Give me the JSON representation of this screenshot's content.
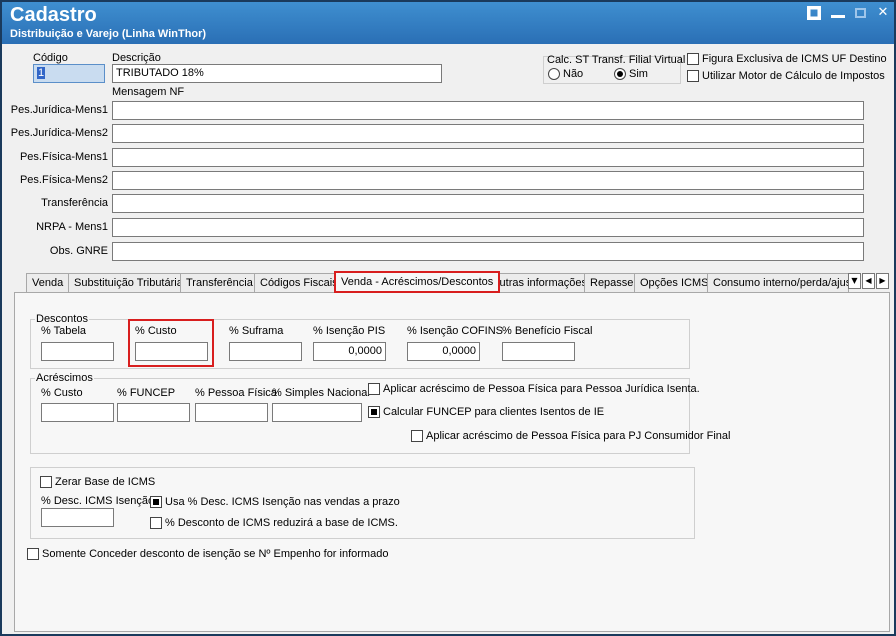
{
  "window": {
    "title": "Cadastro",
    "subtitle": "Distribuição e Varejo (Linha WinThor)"
  },
  "header": {
    "codigo_label": "Código",
    "codigo_value": "1",
    "descricao_label": "Descrição",
    "descricao_value": "TRIBUTADO 18%",
    "mensagem_label": "Mensagem NF",
    "calc_st_label": "Calc. ST Transf. Filial Virtual",
    "radio_nao": "Não",
    "radio_sim": "Sim",
    "radio_selected": "Sim",
    "figura_exclusiva_label": "Figura Exclusiva de ICMS UF Destino",
    "figura_exclusiva_checked": false,
    "utilizar_motor_label": "Utilizar Motor de Cálculo de Impostos",
    "utilizar_motor_checked": false
  },
  "message_fields": [
    {
      "label": "Pes.Jurídica-Mens1",
      "value": ""
    },
    {
      "label": "Pes.Jurídica-Mens2",
      "value": ""
    },
    {
      "label": "Pes.Física-Mens1",
      "value": ""
    },
    {
      "label": "Pes.Física-Mens2",
      "value": ""
    },
    {
      "label": "Transferência",
      "value": ""
    },
    {
      "label": "NRPA - Mens1",
      "value": ""
    },
    {
      "label": "Obs. GNRE",
      "value": ""
    }
  ],
  "tabs": [
    {
      "label": "Venda"
    },
    {
      "label": "Substituição Tributária"
    },
    {
      "label": "Transferência"
    },
    {
      "label": "Códigos Fiscais"
    },
    {
      "label": "Venda - Acréscimos/Descontos"
    },
    {
      "label": "Outras informações"
    },
    {
      "label": "Repasse"
    },
    {
      "label": "Opções ICMS"
    },
    {
      "label": "Consumo interno/perda/ajuste"
    }
  ],
  "active_tab": "Venda - Acréscimos/Descontos",
  "descontos": {
    "group_label": "Descontos",
    "fields": [
      {
        "label": "% Tabela",
        "value": ""
      },
      {
        "label": "% Custo",
        "value": ""
      },
      {
        "label": "% Suframa",
        "value": ""
      },
      {
        "label": "% Isenção PIS",
        "value": "0,0000"
      },
      {
        "label": "% Isenção COFINS",
        "value": "0,0000"
      },
      {
        "label": "% Benefício Fiscal",
        "value": ""
      }
    ]
  },
  "acrescimos": {
    "group_label": "Acréscimos",
    "fields": [
      {
        "label": "% Custo",
        "value": ""
      },
      {
        "label": "% FUNCEP",
        "value": ""
      },
      {
        "label": "% Pessoa Física",
        "value": ""
      },
      {
        "label": "% Simples Nacional",
        "value": ""
      }
    ],
    "checks": [
      {
        "label": "Aplicar acréscimo de Pessoa Física para Pessoa Jurídica Isenta.",
        "checked": false
      },
      {
        "label": "Calcular FUNCEP para clientes Isentos de IE",
        "checked": true
      },
      {
        "label": "Aplicar acréscimo de Pessoa Física para PJ Consumidor Final",
        "checked": false
      }
    ]
  },
  "icms": {
    "zerar_label": "Zerar Base de ICMS",
    "zerar_checked": false,
    "desc_isencao_label": "% Desc. ICMS Isenção",
    "desc_isencao_value": "",
    "usa_desc_label": "Usa % Desc. ICMS Isenção nas vendas a prazo",
    "usa_desc_checked": true,
    "reduzira_label": "% Desconto de ICMS reduzirá a base de ICMS.",
    "reduzira_checked": false
  },
  "somente_conceder_label": "Somente Conceder desconto de isenção se Nº Empenho for informado",
  "somente_conceder_checked": false,
  "colors": {
    "titlebar": "#2a6fb5",
    "highlight_border": "#d81e1e"
  }
}
